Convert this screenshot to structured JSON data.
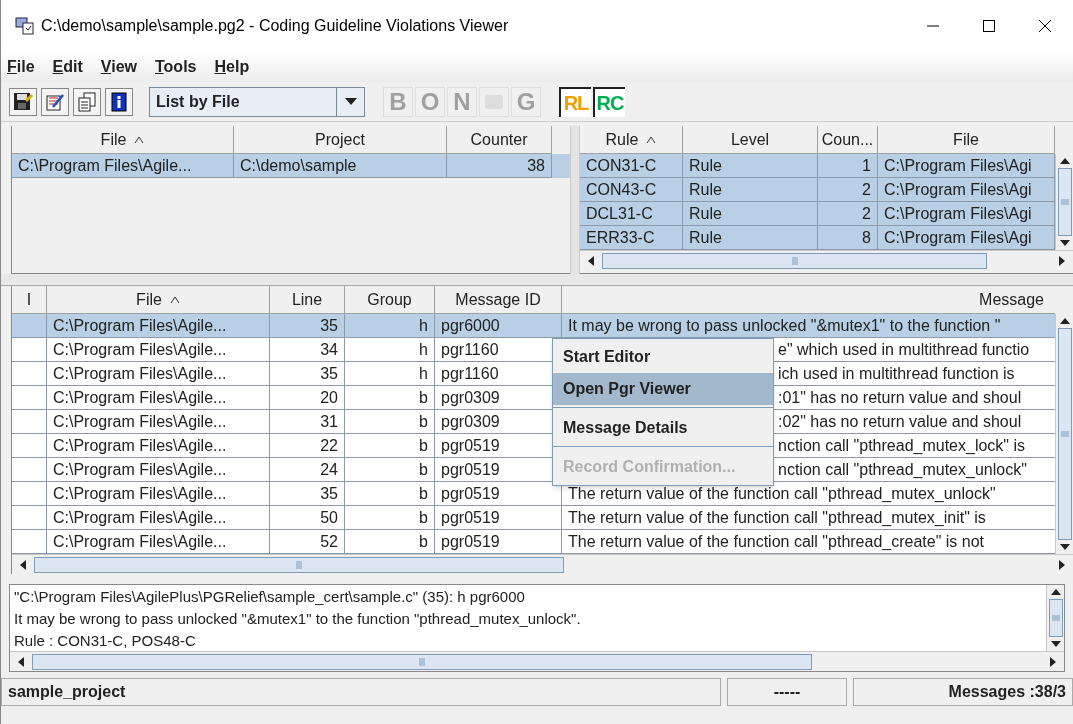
{
  "window": {
    "title": "C:\\demo\\sample\\sample.pg2 - Coding Guideline Violations Viewer"
  },
  "menu": [
    {
      "label": "File"
    },
    {
      "label": "Edit"
    },
    {
      "label": "View"
    },
    {
      "label": "Tools"
    },
    {
      "label": "Help"
    }
  ],
  "toolbar": {
    "tools": [
      {
        "kind": "save"
      },
      {
        "kind": "edit"
      },
      {
        "kind": "documents"
      },
      {
        "kind": "info"
      }
    ],
    "view_select": {
      "value": "List by File"
    },
    "filter_buttons": [
      {
        "kind": "letter",
        "label": "B",
        "disabled": true
      },
      {
        "kind": "letter",
        "label": "O",
        "disabled": true
      },
      {
        "kind": "letter",
        "label": "N",
        "disabled": true
      },
      {
        "kind": "icon",
        "disabled": true
      },
      {
        "kind": "letter",
        "label": "G",
        "disabled": true
      }
    ],
    "rule_buttons": [
      {
        "label": "RL",
        "color": "#f0a000"
      },
      {
        "label": "RC",
        "color": "#00b050"
      }
    ]
  },
  "file_table": {
    "columns": [
      {
        "label": "File",
        "sorted": true
      },
      {
        "label": "Project",
        "sorted": false
      },
      {
        "label": "Counter",
        "sorted": false
      }
    ],
    "rows": [
      {
        "cells": [
          "C:\\Program Files\\Agile...",
          "C:\\demo\\sample",
          "38"
        ],
        "selected": true
      }
    ]
  },
  "rule_table": {
    "columns": [
      {
        "label": "Rule",
        "sorted": true
      },
      {
        "label": "Level",
        "sorted": false
      },
      {
        "label": "Coun...",
        "sorted": false
      },
      {
        "label": "File",
        "sorted": false
      }
    ],
    "rows": [
      {
        "cells": [
          "CON31-C",
          "Rule",
          "1",
          "C:\\Program Files\\Agi"
        ],
        "selected": true
      },
      {
        "cells": [
          "CON43-C",
          "Rule",
          "2",
          "C:\\Program Files\\Agi"
        ],
        "selected": true
      },
      {
        "cells": [
          "DCL31-C",
          "Rule",
          "2",
          "C:\\Program Files\\Agi"
        ],
        "selected": true
      },
      {
        "cells": [
          "ERR33-C",
          "Rule",
          "8",
          "C:\\Program Files\\Agi"
        ],
        "selected": true
      }
    ]
  },
  "message_table": {
    "columns": [
      {
        "label": "I",
        "sorted": false
      },
      {
        "label": "File",
        "sorted": true
      },
      {
        "label": "Line",
        "sorted": false
      },
      {
        "label": "Group",
        "sorted": false
      },
      {
        "label": "Message ID",
        "sorted": false
      },
      {
        "label": "Message",
        "sorted": false
      }
    ],
    "rows": [
      {
        "cells": [
          "",
          "C:\\Program Files\\Agile...",
          "35",
          "h",
          "pgr6000",
          "It may be wrong to pass unlocked \"&mutex1\" to the function \""
        ],
        "selected": true,
        "covered": false
      },
      {
        "cells": [
          "",
          "C:\\Program Files\\Agile...",
          "34",
          "h",
          "pgr1160",
          "e\" which used in multithread functio"
        ],
        "selected": false,
        "covered": true
      },
      {
        "cells": [
          "",
          "C:\\Program Files\\Agile...",
          "35",
          "h",
          "pgr1160",
          "ich used in multithread function is"
        ],
        "selected": false,
        "covered": true
      },
      {
        "cells": [
          "",
          "C:\\Program Files\\Agile...",
          "20",
          "b",
          "pgr0309",
          ":01\" has no return value and shoul"
        ],
        "selected": false,
        "covered": true
      },
      {
        "cells": [
          "",
          "C:\\Program Files\\Agile...",
          "31",
          "b",
          "pgr0309",
          ":02\" has no return value and shoul"
        ],
        "selected": false,
        "covered": true
      },
      {
        "cells": [
          "",
          "C:\\Program Files\\Agile...",
          "22",
          "b",
          "pgr0519",
          "nction call \"pthread_mutex_lock\" is"
        ],
        "selected": false,
        "covered": true
      },
      {
        "cells": [
          "",
          "C:\\Program Files\\Agile...",
          "24",
          "b",
          "pgr0519",
          "nction call \"pthread_mutex_unlock\""
        ],
        "selected": false,
        "covered": true
      },
      {
        "cells": [
          "",
          "C:\\Program Files\\Agile...",
          "35",
          "b",
          "pgr0519",
          "The return value of the function call \"pthread_mutex_unlock\""
        ],
        "selected": false,
        "covered": false
      },
      {
        "cells": [
          "",
          "C:\\Program Files\\Agile...",
          "50",
          "b",
          "pgr0519",
          "The return value of the function call \"pthread_mutex_init\" is"
        ],
        "selected": false,
        "covered": false
      },
      {
        "cells": [
          "",
          "C:\\Program Files\\Agile...",
          "52",
          "b",
          "pgr0519",
          "The return value of the function call \"pthread_create\" is not"
        ],
        "selected": false,
        "covered": false
      }
    ]
  },
  "context_menu": [
    {
      "kind": "item",
      "label": "Start Editor",
      "selected": false,
      "disabled": false
    },
    {
      "kind": "item",
      "label": "Open Pgr Viewer",
      "selected": true,
      "disabled": false
    },
    {
      "kind": "separator"
    },
    {
      "kind": "item",
      "label": "Message Details",
      "selected": false,
      "disabled": false
    },
    {
      "kind": "separator"
    },
    {
      "kind": "item",
      "label": "Record Confirmation...",
      "selected": false,
      "disabled": true
    }
  ],
  "details": [
    "\"C:\\Program Files\\AgilePlus\\PGRelief\\sample_cert\\sample.c\" (35): h pgr6000",
    "It may be wrong to pass unlocked \"&mutex1\" to the function \"pthread_mutex_unlock\".",
    "Rule : CON31-C, POS48-C"
  ],
  "status_bar": [
    "sample_project",
    "-----",
    "Messages :38/3"
  ]
}
